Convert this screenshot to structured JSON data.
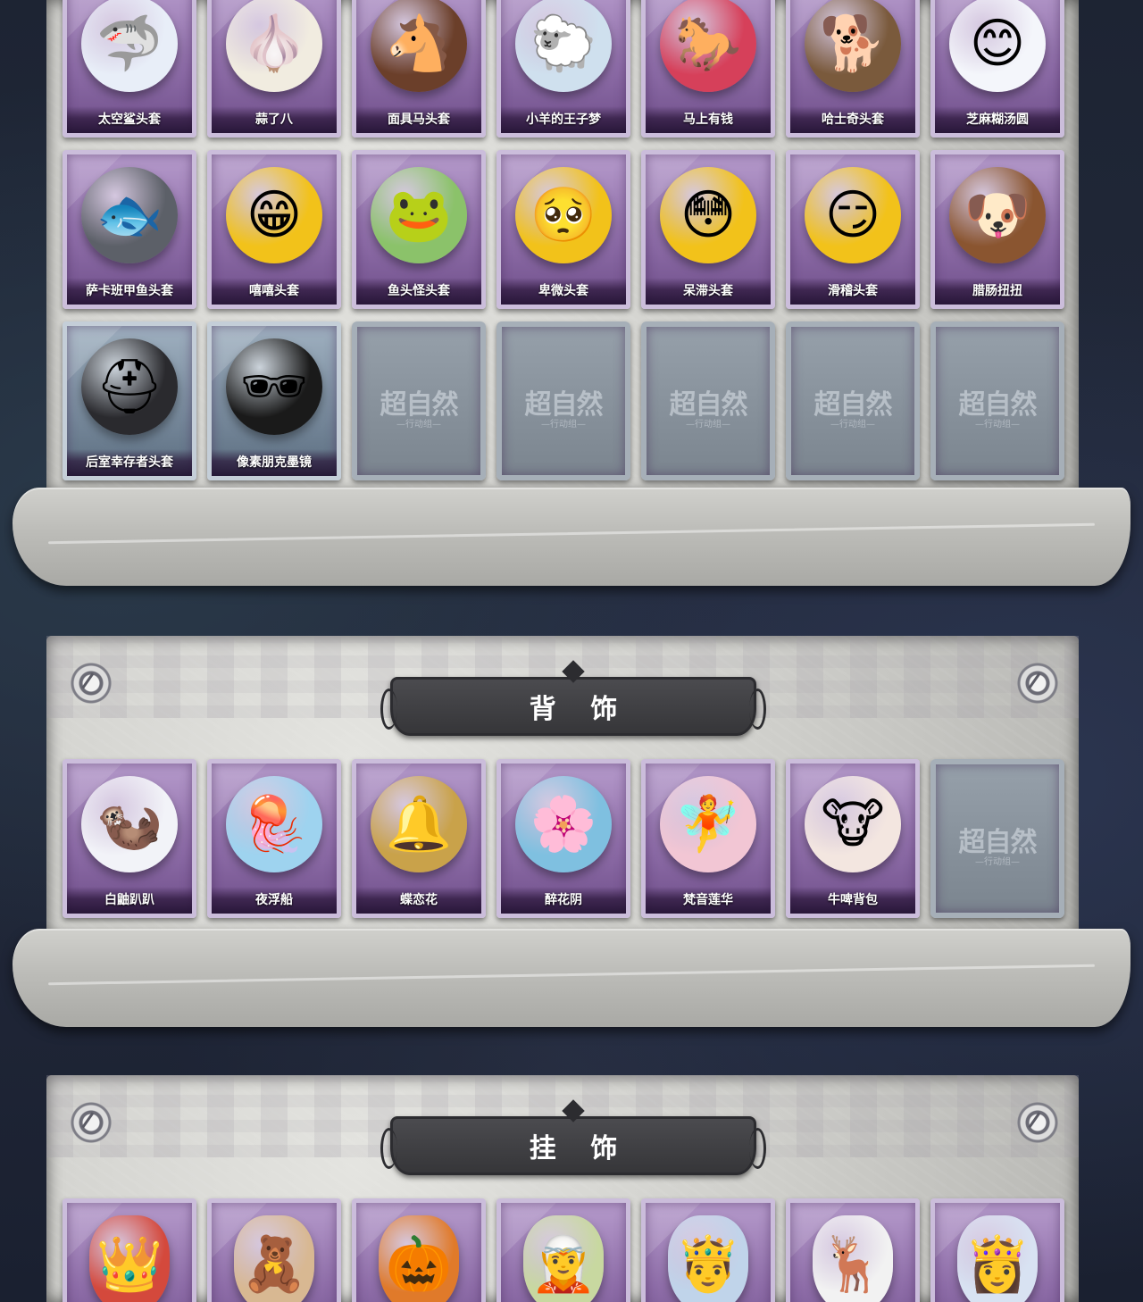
{
  "sections": {
    "headwear": {
      "row1": [
        {
          "name": "太空鲨头套",
          "icon": "shark-head-icon",
          "glyph": "🦈",
          "color": "#e8eef8"
        },
        {
          "name": "蒜了八",
          "icon": "garlic-head-icon",
          "glyph": "🧄",
          "color": "#f1ece0"
        },
        {
          "name": "面具马头套",
          "icon": "horse-head-icon",
          "glyph": "🐴",
          "color": "#6b3f2a"
        },
        {
          "name": "小羊的王子梦",
          "icon": "sheep-crown-icon",
          "glyph": "🐑",
          "color": "#cfe0ee"
        },
        {
          "name": "马上有钱",
          "icon": "red-horse-icon",
          "glyph": "🐎",
          "color": "#d6405a"
        },
        {
          "name": "哈士奇头套",
          "icon": "husky-head-icon",
          "glyph": "🐕",
          "color": "#7a5a3c"
        },
        {
          "name": "芝麻糊汤圆",
          "icon": "dumpling-head-icon",
          "glyph": "😊",
          "color": "#f4f6fb"
        }
      ],
      "row2": [
        {
          "name": "萨卡班甲鱼头套",
          "icon": "fish-head-icon",
          "glyph": "🐟",
          "color": "#5c6068"
        },
        {
          "name": "嘻嘻头套",
          "icon": "grin-emoji-icon",
          "glyph": "😁",
          "color": "#f2c21a"
        },
        {
          "name": "鱼头怪头套",
          "icon": "fishman-head-icon",
          "glyph": "🐸",
          "color": "#8bc26a"
        },
        {
          "name": "卑微头套",
          "icon": "humble-emoji-icon",
          "glyph": "🥺",
          "color": "#f2c21a"
        },
        {
          "name": "呆滞头套",
          "icon": "stunned-emoji-icon",
          "glyph": "😳",
          "color": "#f2c21a"
        },
        {
          "name": "滑稽头套",
          "icon": "funny-emoji-icon",
          "glyph": "😏",
          "color": "#f2c21a"
        },
        {
          "name": "腊肠扭扭",
          "icon": "dachshund-head-icon",
          "glyph": "🐶",
          "color": "#8a5530"
        }
      ],
      "row3": [
        {
          "name": "后室幸存者头套",
          "icon": "gas-mask-icon",
          "glyph": "⛑",
          "color": "#2a2a2e",
          "rarity": "blue"
        },
        {
          "name": "像素朋克墨镜",
          "icon": "pixel-sunglasses-icon",
          "glyph": "🕶",
          "color": "#1a1a1a",
          "rarity": "blue"
        }
      ],
      "row3_empty_count": 5
    },
    "back": {
      "title": "背 饰",
      "items": [
        {
          "name": "白鼬趴趴",
          "icon": "ermine-icon",
          "glyph": "🦦",
          "color": "#f2f3f8"
        },
        {
          "name": "夜浮船",
          "icon": "jellyfish-icon",
          "glyph": "🪼",
          "color": "#9ed3ef"
        },
        {
          "name": "蝶恋花",
          "icon": "butterfly-bell-icon",
          "glyph": "🔔",
          "color": "#c9a24a"
        },
        {
          "name": "醉花阴",
          "icon": "flower-wreath-icon",
          "glyph": "🌸",
          "color": "#7fc0e0"
        },
        {
          "name": "梵音莲华",
          "icon": "lotus-fairy-icon",
          "glyph": "🧚",
          "color": "#f2c6d4"
        },
        {
          "name": "牛啤背包",
          "icon": "cow-beer-icon",
          "glyph": "🐮",
          "color": "#f3e6e0"
        }
      ],
      "empty_count": 1
    },
    "pendant": {
      "title": "挂 饰",
      "items": [
        {
          "icon": "opera-doll-icon",
          "glyph": "👑",
          "color": "#d4493c"
        },
        {
          "icon": "bear-charm-icon",
          "glyph": "🧸",
          "color": "#d8b892"
        },
        {
          "icon": "pumpkin-charm-icon",
          "glyph": "🎃",
          "color": "#e07a2a"
        },
        {
          "icon": "elf-charm-icon",
          "glyph": "🧝",
          "color": "#c8d8a0"
        },
        {
          "icon": "prince-charm-icon",
          "glyph": "🤴",
          "color": "#c0d4ea"
        },
        {
          "icon": "deer-charm-icon",
          "glyph": "🦌",
          "color": "#f2f2f2"
        },
        {
          "icon": "fairy-charm-icon",
          "glyph": "👸",
          "color": "#d8e2f2"
        }
      ]
    }
  },
  "empty_slot": {
    "logo": "超自然",
    "sub": "—行动组—"
  }
}
